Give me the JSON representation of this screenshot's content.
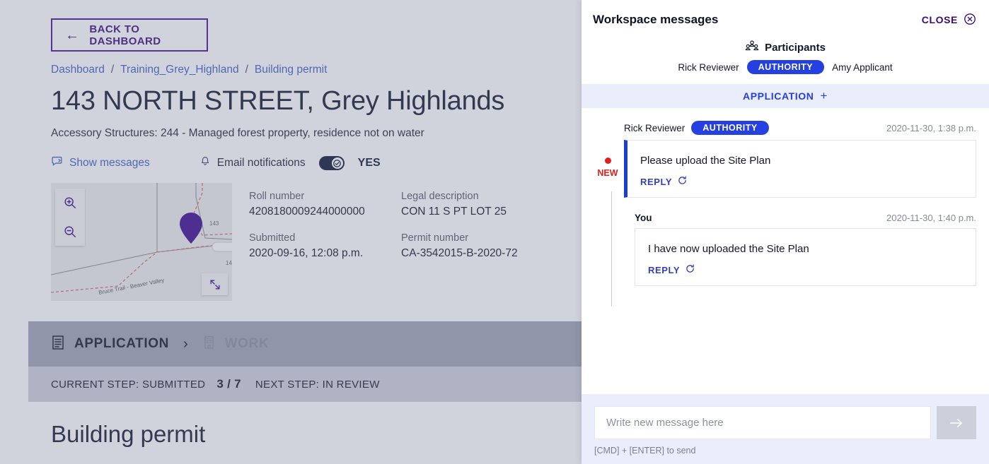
{
  "page": {
    "back_button": "BACK TO DASHBOARD",
    "breadcrumb": [
      "Dashboard",
      "Training_Grey_Highland",
      "Building permit"
    ],
    "breadcrumb_separator": "/",
    "address_title": "143 NORTH STREET, Grey Highlands",
    "address_subtitle": "Accessory Structures: 244 - Managed forest property, residence not on water",
    "show_messages_label": "Show messages",
    "email_notifications_label": "Email notifications",
    "email_notifications_value": "YES",
    "map": {
      "street_label": "Bruce Trail - Beaver Valley",
      "parcel_label_1": "143",
      "parcel_label_2": "14"
    },
    "details": [
      {
        "label": "Roll number",
        "value": "4208180009244000000"
      },
      {
        "label": "Legal description",
        "value": "CON 11 S PT LOT 25"
      },
      {
        "label": "Submitted",
        "value": "2020-09-16, 12:08 p.m."
      },
      {
        "label": "Permit number",
        "value": "CA-3542015-B-2020-72"
      }
    ],
    "tabs": [
      {
        "label": "APPLICATION",
        "icon": "document-icon",
        "active": true
      },
      {
        "label": "WORK",
        "icon": "building-icon",
        "active": false
      }
    ],
    "tab_caret": "›",
    "step": {
      "current_label": "CURRENT STEP: SUBMITTED",
      "count": "3 / 7",
      "next_label": "NEXT STEP: IN REVIEW"
    },
    "permit_title": "Building permit"
  },
  "panel": {
    "title": "Workspace messages",
    "close_label": "CLOSE",
    "participants_label": "Participants",
    "participants": [
      {
        "name": "Rick Reviewer",
        "badge": "AUTHORITY"
      },
      {
        "name": "Amy Applicant",
        "badge": ""
      }
    ],
    "section_divider": {
      "label": "APPLICATION",
      "plus": "+"
    },
    "messages": [
      {
        "author": "Rick Reviewer",
        "badge": "AUTHORITY",
        "timestamp": "2020-11-30, 1:38 p.m.",
        "text": "Please upload the Site Plan",
        "reply_label": "REPLY",
        "new_label": "NEW"
      },
      {
        "author": "You",
        "badge": "",
        "timestamp": "2020-11-30, 1:40 p.m.",
        "text": "I have now uploaded the Site Plan",
        "reply_label": "REPLY",
        "new_label": ""
      }
    ],
    "composer": {
      "placeholder": "Write new message here",
      "value": "",
      "hint": "[CMD] + [ENTER] to send"
    }
  },
  "colors": {
    "accent_purple": "#3d0b78",
    "link_blue": "#3c5fc4",
    "badge_blue": "#2540e0",
    "new_red": "#e02020",
    "tabbar_gray": "#a0a3b5",
    "stepbar_gray": "#cdcfda"
  }
}
